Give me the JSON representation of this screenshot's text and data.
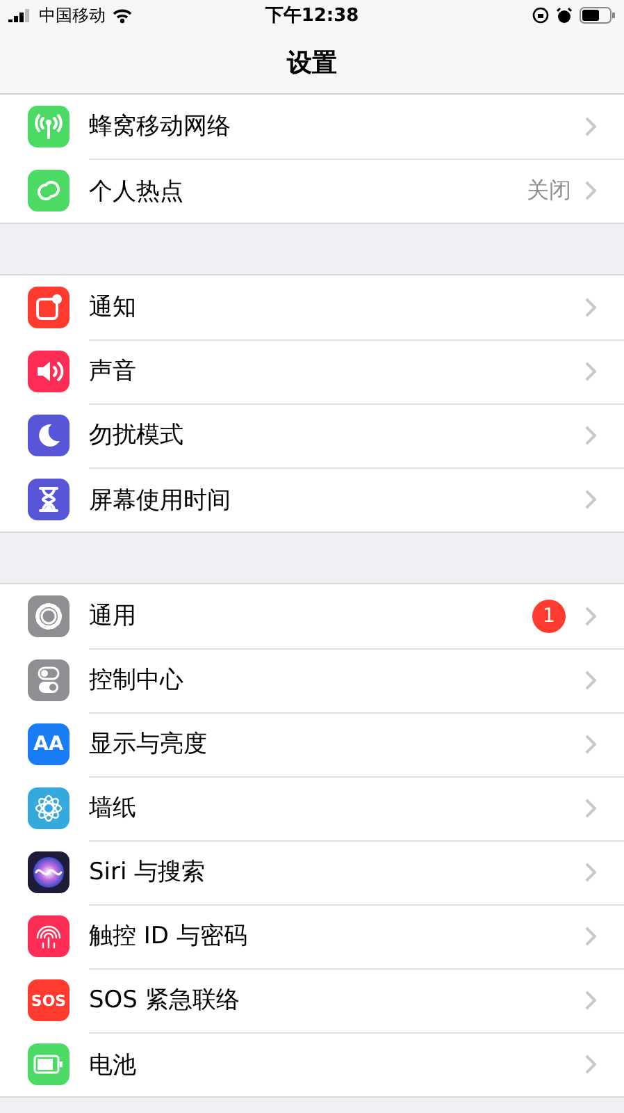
{
  "status_bar": {
    "carrier": "中国移动",
    "time": "下午12:38"
  },
  "nav": {
    "title": "设置"
  },
  "groups": [
    {
      "rows": [
        {
          "kind": "antenna",
          "color": "#4cd964",
          "label": "蜂窝移动网络"
        },
        {
          "kind": "chain",
          "color": "#4cd964",
          "label": "个人热点",
          "value": "关闭"
        }
      ]
    },
    {
      "rows": [
        {
          "kind": "notification",
          "color": "#ff3b30",
          "label": "通知"
        },
        {
          "kind": "speaker",
          "color": "#ff2d55",
          "label": "声音"
        },
        {
          "kind": "moon",
          "color": "#5856d6",
          "label": "勿扰模式"
        },
        {
          "kind": "hourglass",
          "color": "#5856d6",
          "label": "屏幕使用时间"
        }
      ]
    },
    {
      "rows": [
        {
          "kind": "gear",
          "color": "#8e8e93",
          "label": "通用",
          "badge": "1"
        },
        {
          "kind": "toggles",
          "color": "#8e8e93",
          "label": "控制中心"
        },
        {
          "kind": "text",
          "color": "#1a7cf5",
          "label": "显示与亮度",
          "icon_text": "AA"
        },
        {
          "kind": "flower",
          "color": "#35a9dd",
          "label": "墙纸"
        },
        {
          "kind": "orb",
          "color": "#1d1d3a",
          "label": "Siri 与搜索"
        },
        {
          "kind": "fingerprint",
          "color": "#ff2d55",
          "label": "触控 ID 与密码"
        },
        {
          "kind": "text",
          "color": "#ff3b30",
          "label": "SOS 紧急联络",
          "icon_text": "SOS"
        },
        {
          "kind": "battery",
          "color": "#4cd964",
          "label": "电池"
        }
      ]
    }
  ]
}
